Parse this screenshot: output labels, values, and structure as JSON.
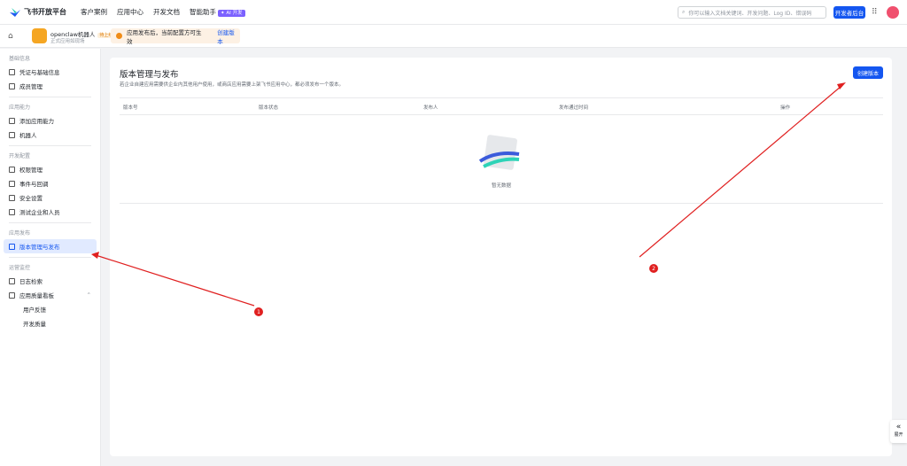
{
  "header": {
    "brand": "飞书开放平台",
    "nav": [
      "客户案例",
      "应用中心",
      "开发文档",
      "智能助手"
    ],
    "ai_badge": "✦ AI 开发",
    "search_placeholder": "你可以输入文档关键词、开发问题、Log ID、错误码",
    "dev_console": "开发者后台"
  },
  "app": {
    "name": "openclaw机器人",
    "status": "待上线",
    "subtitle": "正式应用如现场",
    "notice": "应用发布后，当前配置方可生效",
    "notice_link": "创建版本"
  },
  "sidebar": [
    {
      "section": "基础信息",
      "items": [
        "凭证与基础信息",
        "成员管理"
      ]
    },
    {
      "section": "应用能力",
      "items": [
        "添加应用能力",
        "机器人"
      ]
    },
    {
      "section": "开发配置",
      "items": [
        "权限管理",
        "事件与回调",
        "安全设置",
        "测试企业和人员"
      ]
    },
    {
      "section": "应用发布",
      "items": [
        "版本管理与发布"
      ]
    },
    {
      "section": "运营监控",
      "items": [
        "日志检索",
        "应用质量看板",
        "用户反馈",
        "开发质量"
      ]
    }
  ],
  "main": {
    "title": "版本管理与发布",
    "description": "若企业自建应用需要供企业内其他用户使用，或商店应用需要上架飞书应用中心，都必须发布一个版本。",
    "create_button": "创建版本",
    "columns": [
      "版本号",
      "版本状态",
      "发布人",
      "发布通过时间",
      "操作"
    ],
    "empty": "暂无数据"
  },
  "expand": "展开",
  "annotations": [
    "1",
    "2"
  ],
  "colors": {
    "primary": "#1456f0",
    "annotation": "#e02020"
  }
}
